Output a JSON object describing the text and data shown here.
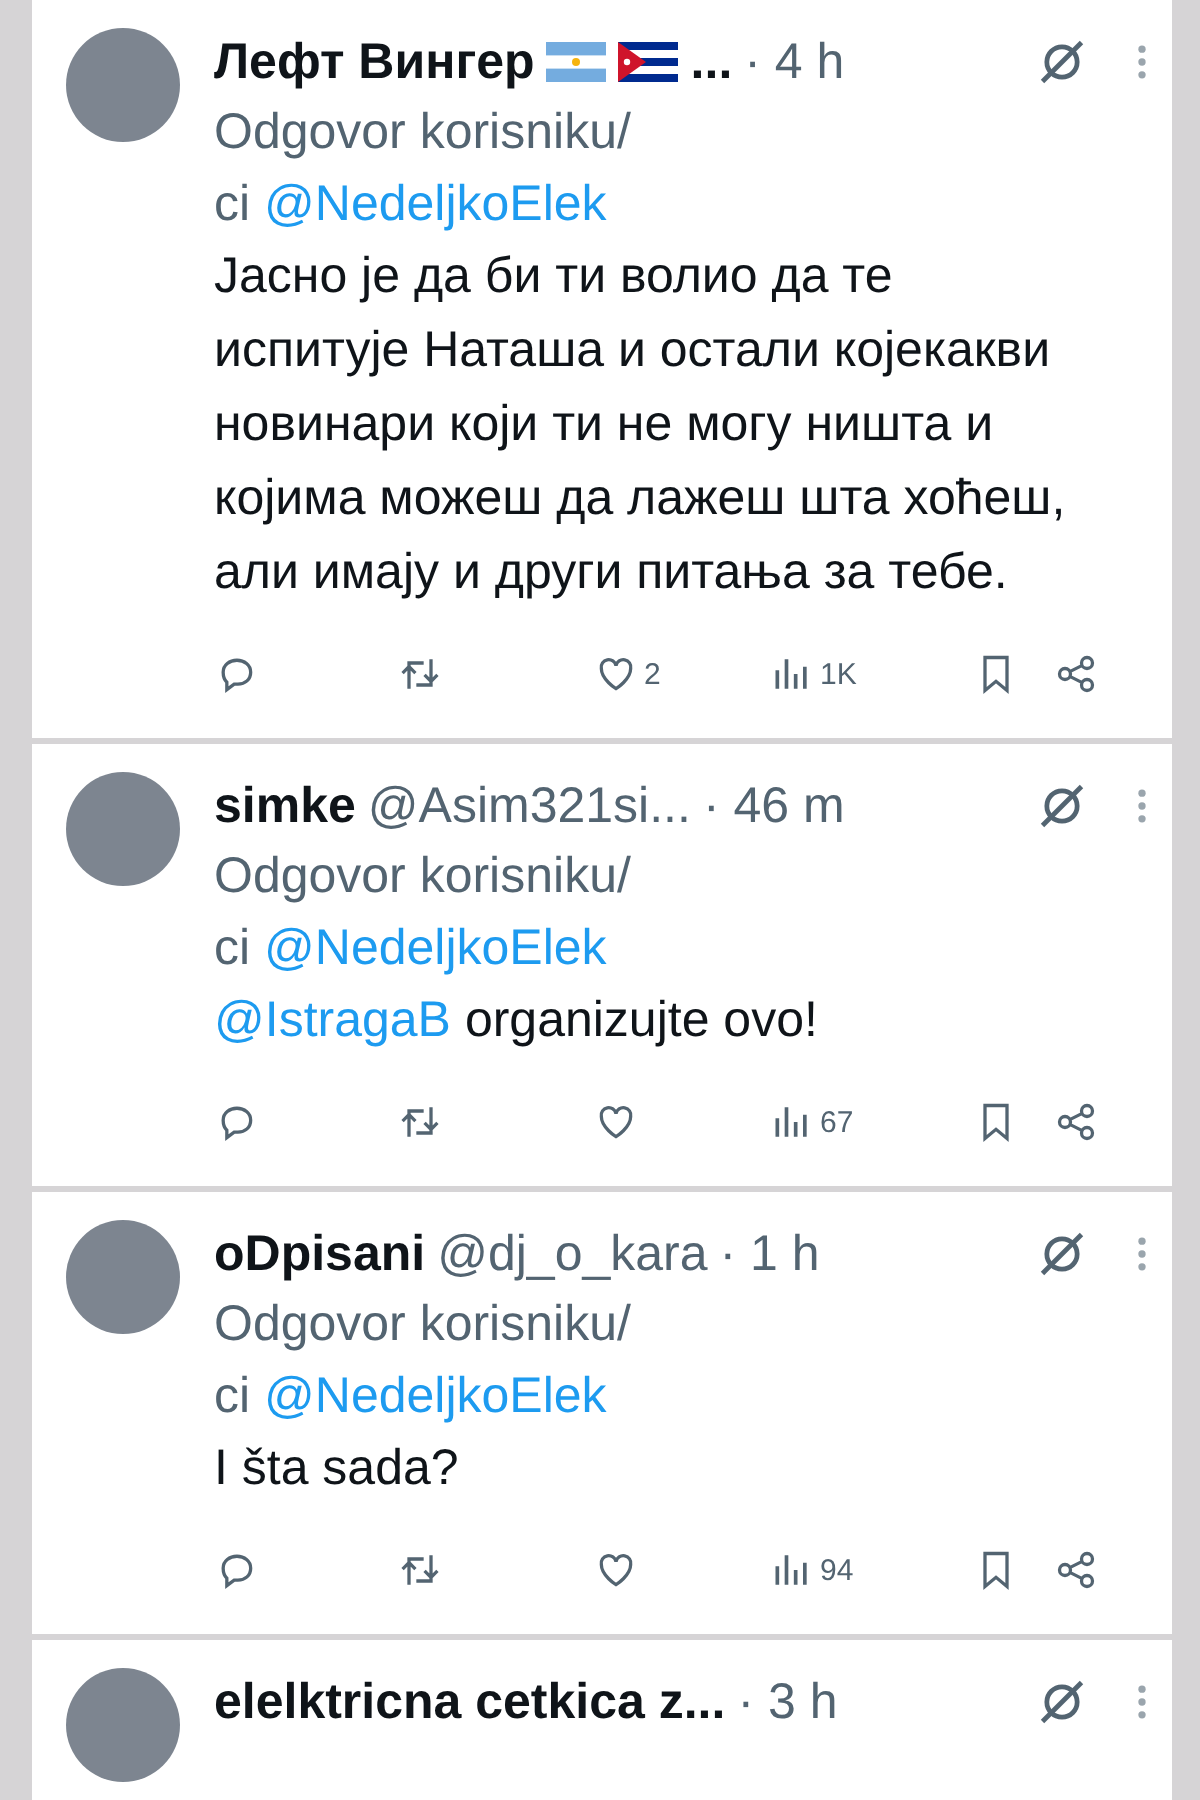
{
  "tweets": [
    {
      "name": "Лефт Вингер",
      "flags": true,
      "name_suffix": "...",
      "time": "· 4 h",
      "reply_prefix": "Odgovor korisniku/",
      "reply_prefix_2": "ci",
      "reply_to": "@NedeljkoElek",
      "body": "Јасно је да би ти волио да те испитује Наташа и остали којекакви новинари који ти не могу ништа и којима можеш да лажеш шта хоћеш, али имају и други питања за тебе.",
      "likes": "2",
      "views": "1K"
    },
    {
      "name": "simke",
      "handle": "@Asim321si...",
      "time": "· 46 m",
      "reply_prefix": "Odgovor korisniku/",
      "reply_prefix_2": "ci",
      "reply_to": "@NedeljkoElek",
      "mention": "@IstragaB",
      "body": "organizujte ovo!",
      "views": "67"
    },
    {
      "name": "oDpisani",
      "handle": "@dj_o_kara",
      "time": "· 1 h",
      "reply_prefix": "Odgovor korisniku/",
      "reply_prefix_2": "ci",
      "reply_to": "@NedeljkoElek",
      "body": "I šta sada?",
      "views": "94"
    },
    {
      "name": "elelktricna cetkica z...",
      "time": "· 3 h"
    }
  ]
}
